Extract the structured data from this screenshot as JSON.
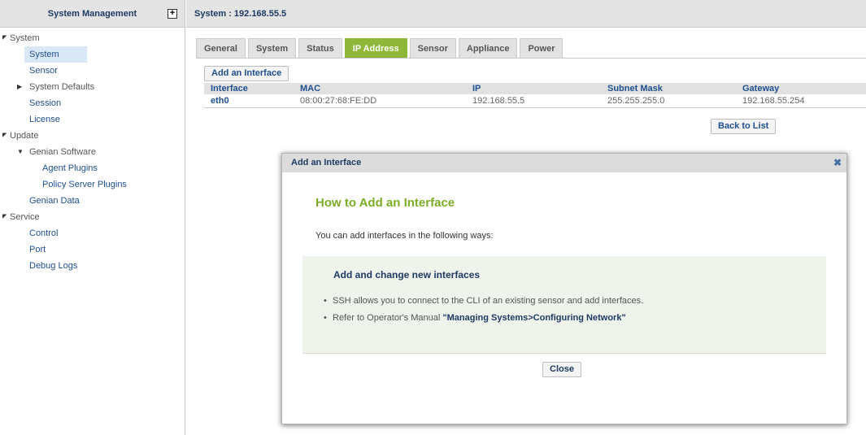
{
  "sidebar": {
    "title": "System Management",
    "expand_icon": "+",
    "tree": {
      "system_group": "System",
      "system": "System",
      "sensor": "Sensor",
      "system_defaults": "System Defaults",
      "session": "Session",
      "license": "License",
      "update_group": "Update",
      "genian_software": "Genian Software",
      "agent_plugins": "Agent Plugins",
      "policy_server_plugins": "Policy Server Plugins",
      "genian_data": "Genian Data",
      "service_group": "Service",
      "control": "Control",
      "port": "Port",
      "debug_logs": "Debug Logs"
    }
  },
  "main": {
    "title": "System : 192.168.55.5",
    "tabs": [
      "General",
      "System",
      "Status",
      "IP Address",
      "Sensor",
      "Appliance",
      "Power"
    ],
    "active_tab": "IP Address",
    "add_button": "Add an Interface",
    "back_button": "Back to List",
    "table": {
      "headers": [
        "Interface",
        "MAC",
        "IP",
        "Subnet Mask",
        "Gateway"
      ],
      "rows": [
        [
          "eth0",
          "08:00:27:68:FE:DD",
          "192.168.55.5",
          "255.255.255.0",
          "192.168.55.254"
        ]
      ]
    }
  },
  "modal": {
    "title": "Add an Interface",
    "close_x": "✖",
    "heading": "How to Add an Interface",
    "intro": "You can add interfaces in the following ways:",
    "box_title": "Add and change new interfaces",
    "bullet1": "SSH allows you to connect to the CLI of an existing sensor and add interfaces.",
    "bullet2_prefix": "Refer to Operator's Manual ",
    "bullet2_link": "\"Managing Systems>Configuring Network\"",
    "close_button": "Close"
  },
  "colors": {
    "accent_green": "#8fb83a",
    "link_blue": "#1f4f8f",
    "title_navy": "#1f3a63"
  }
}
